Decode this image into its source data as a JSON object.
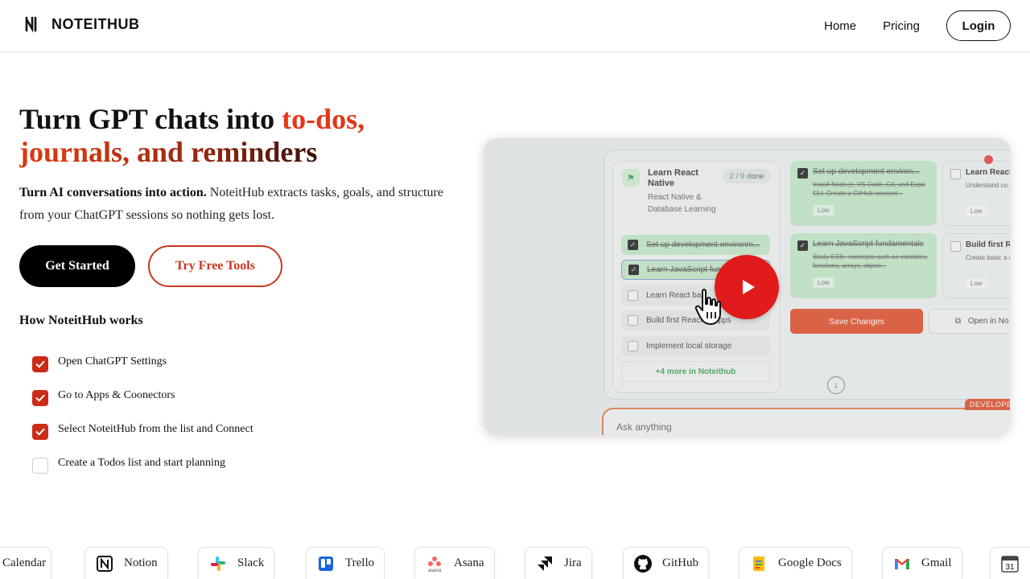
{
  "nav": {
    "brand": "NOTEITHUB",
    "links": [
      "Home",
      "Pricing"
    ],
    "login": "Login"
  },
  "hero": {
    "headline_plain": "Turn GPT chats into ",
    "headline_accent": "to-dos, journals, and reminders",
    "subtitle_bold": "Turn AI conversations into action.",
    "subtitle_rest": " NoteitHub extracts tasks, goals, and structure from your ChatGPT sessions so nothing gets lost.",
    "cta_primary": "Get Started",
    "cta_secondary": "Try Free Tools"
  },
  "how": {
    "title": "How NoteitHub works",
    "steps": [
      {
        "label": "Open ChatGPT Settings",
        "checked": true
      },
      {
        "label": "Go to Apps & Coonectors",
        "checked": true
      },
      {
        "label": "Select NoteitHub from the list and Connect",
        "checked": true
      },
      {
        "label": "Create a Todos list and start planning",
        "checked": false
      }
    ]
  },
  "video": {
    "project_title": "Learn React Native",
    "project_sub": "React Native & Database Learning",
    "done_count": "2 / 9",
    "done_word": "done",
    "tasks": [
      {
        "label": "Set up development environm...",
        "done": true
      },
      {
        "label": "Learn JavaScript fun...",
        "done": true
      },
      {
        "label": "Learn React ba...",
        "done": false
      },
      {
        "label": "Build first React ... apps",
        "done": false
      },
      {
        "label": "Implement local storage",
        "done": false
      }
    ],
    "more": "+4 more in Noteithub",
    "cards": [
      {
        "title": "Set up development environ...",
        "desc": "Install Node.js, VS Code, Git, and Expo CLI. Create a GitHub account...",
        "badge": "Low",
        "done": true
      },
      {
        "title": "Learn React",
        "desc": "Understand co props, state, u",
        "badge": "Low",
        "done": false
      },
      {
        "title": "Learn JavaScript fundamentals",
        "desc": "Study ES6+ concepts such as variables, functions, arrays, object...",
        "badge": "Low",
        "done": true
      },
      {
        "title": "Build first Re",
        "desc": "Create basic a components, s",
        "badge": "Low",
        "done": false
      }
    ],
    "save": "Save Changes",
    "open": "Open in No",
    "ask": "Ask anything",
    "dev_tag": "DEVELOPER"
  },
  "integrations": [
    "Calendar",
    "Notion",
    "Slack",
    "Trello",
    "Asana",
    "Jira",
    "GitHub",
    "Google Docs",
    "Gmail"
  ],
  "colors": {
    "accent": "#cc2b17",
    "play": "#e11b1b",
    "save": "#e0401a"
  }
}
